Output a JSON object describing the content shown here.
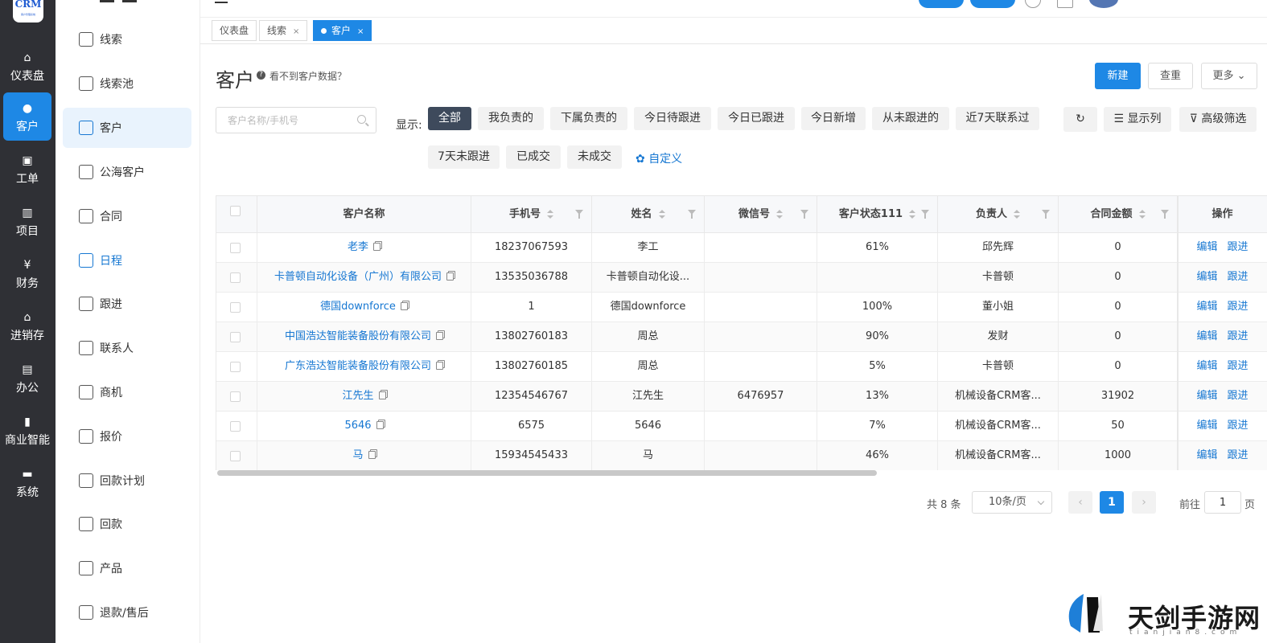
{
  "app": {
    "logo_text": "CRM",
    "logo_sub": "客户管理系统"
  },
  "rail": [
    {
      "label": "仪表盘",
      "icon": "home-icon",
      "glyph": "⌂"
    },
    {
      "label": "客户",
      "icon": "user-icon",
      "glyph": "👤"
    },
    {
      "label": "工单",
      "icon": "clipboard-icon",
      "glyph": "▣"
    },
    {
      "label": "项目",
      "icon": "books-icon",
      "glyph": "▥"
    },
    {
      "label": "财务",
      "icon": "money-icon",
      "glyph": "¥"
    },
    {
      "label": "进销存",
      "icon": "warehouse-icon",
      "glyph": "⌂"
    },
    {
      "label": "办公",
      "icon": "office-icon",
      "glyph": "▤"
    },
    {
      "label": "商业智能",
      "icon": "bar-chart-icon",
      "glyph": "▮"
    },
    {
      "label": "系统",
      "icon": "system-icon",
      "glyph": "▬"
    }
  ],
  "submenu": [
    {
      "label": "线索",
      "icon": "lead-icon"
    },
    {
      "label": "线索池",
      "icon": "lead-pool-icon"
    },
    {
      "label": "客户",
      "icon": "customer-icon"
    },
    {
      "label": "公海客户",
      "icon": "public-customer-icon"
    },
    {
      "label": "合同",
      "icon": "contract-icon"
    },
    {
      "label": "日程",
      "icon": "schedule-icon"
    },
    {
      "label": "跟进",
      "icon": "follow-up-icon"
    },
    {
      "label": "联系人",
      "icon": "contact-icon"
    },
    {
      "label": "商机",
      "icon": "opportunity-icon"
    },
    {
      "label": "报价",
      "icon": "quote-icon"
    },
    {
      "label": "回款计划",
      "icon": "payment-plan-icon"
    },
    {
      "label": "回款",
      "icon": "payment-icon"
    },
    {
      "label": "产品",
      "icon": "product-icon"
    },
    {
      "label": "退款/售后",
      "icon": "refund-icon"
    }
  ],
  "tabs": [
    {
      "label": "仪表盘",
      "closable": false
    },
    {
      "label": "线索",
      "closable": true
    },
    {
      "label": "客户",
      "closable": true
    }
  ],
  "page": {
    "title": "客户",
    "help_text": "看不到客户数据？",
    "new_button": "新建",
    "dedup_button": "查重",
    "more_button": "更多"
  },
  "filters": {
    "search_placeholder": "客户名称/手机号",
    "show_label": "显示:",
    "chips": [
      "全部",
      "我负责的",
      "下属负责的",
      "今日待跟进",
      "今日已跟进",
      "今日新增",
      "从未跟进的",
      "近7天联系过",
      "7天未跟进",
      "已成交",
      "未成交"
    ],
    "custom_label": "自定义",
    "display_columns": "显示列",
    "advanced_filter": "高级筛选"
  },
  "table": {
    "columns": [
      "客户名称",
      "手机号",
      "姓名",
      "微信号",
      "客户状态111",
      "负责人",
      "合同金额",
      "操作"
    ],
    "rows": [
      [
        "老李",
        "18237067593",
        "李工",
        "",
        "61%",
        "邱先辉",
        "0"
      ],
      [
        "卡普顿自动化设备（广州）有限公司",
        "13535036788",
        "卡普顿自动化设...",
        "",
        "",
        "卡普顿",
        "0"
      ],
      [
        "德国downforce",
        "1",
        "德国downforce",
        "",
        "100%",
        "董小姐",
        "0"
      ],
      [
        "中国浩达智能装备股份有限公司",
        "13802760183",
        "周总",
        "",
        "90%",
        "发财",
        "0"
      ],
      [
        "广东浩达智能装备股份有限公司",
        "13802760185",
        "周总",
        "",
        "5%",
        "卡普顿",
        "0"
      ],
      [
        "江先生",
        "12354546767",
        "江先生",
        "6476957",
        "13%",
        "机械设备CRM客...",
        "31902"
      ],
      [
        "5646",
        "6575",
        "5646",
        "",
        "7%",
        "机械设备CRM客...",
        "50"
      ],
      [
        "马",
        "15934545433",
        "马",
        "",
        "46%",
        "机械设备CRM客...",
        "1000"
      ]
    ],
    "edit_label": "编辑",
    "follow_label": "跟进"
  },
  "pagination": {
    "total": "共 8 条",
    "page_size": "10条/页",
    "current_page": "1",
    "goto_prefix": "前往",
    "goto_value": "1",
    "goto_suffix": "页"
  },
  "watermark": {
    "text": "天剑手游网",
    "sub": "tianjian8.com"
  },
  "colors": {
    "primary": "#1e88e5",
    "rail_bg": "#2f3035",
    "link": "#1677d2",
    "chip_active": "#3e4a5c"
  }
}
